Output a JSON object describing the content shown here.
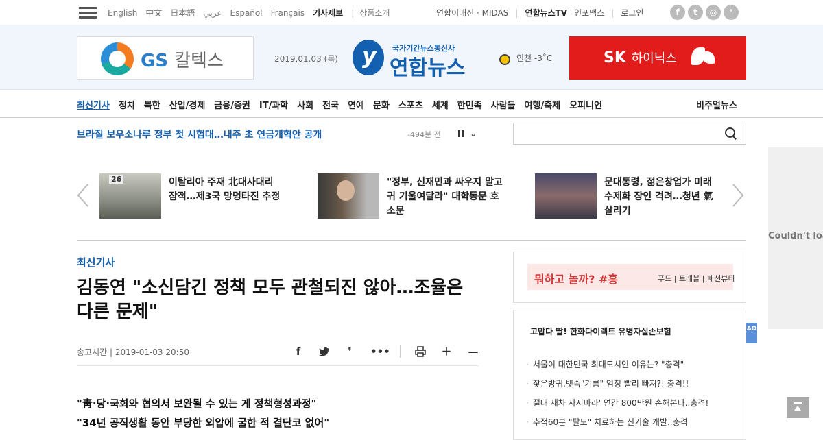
{
  "topbar": {
    "langs": [
      "English",
      "中文",
      "日本語",
      "عربي",
      "Español",
      "Français"
    ],
    "report_label": "기사제보",
    "product_label": "상품소개",
    "links": [
      "연합이매진 · MIDAS"
    ],
    "tv_label": "연합뉴스TV",
    "infomax_label": "인포맥스",
    "login_label": "로그인",
    "social": [
      "f",
      "t",
      "◎",
      "❜"
    ]
  },
  "header": {
    "gs_brand": "GS",
    "gs_name": "칼텍스",
    "date": "2019.01.03 (목)",
    "logo_sub": "국가기간뉴스통신사",
    "logo_main": "연합뉴스",
    "weather": "인천 -3˚C",
    "sk_brand": "SK",
    "sk_name": "하이닉스"
  },
  "nav": {
    "items": [
      "최신기사",
      "정치",
      "북한",
      "산업/경제",
      "금융/증권",
      "IT/과학",
      "사회",
      "전국",
      "연예",
      "문화",
      "스포츠",
      "세계",
      "한민족",
      "사람들",
      "여행/축제",
      "오피니언"
    ],
    "visual": "비주얼뉴스"
  },
  "ticker": {
    "headline": "브라질 보우소나루 정부 첫 시험대…내주 초 연금개혁안 공개",
    "time": "-494분 전"
  },
  "search": {
    "placeholder": ""
  },
  "carousel": [
    {
      "title": "이탈리아 주재 北대사대리 잠적…제3국 망명타진 추정"
    },
    {
      "title": "\"정부, 신재민과 싸우지 말고 귀 기울여달라\" 대학동문 호소문"
    },
    {
      "title": "문대통령, 젊은창업가 미래 수제화 장인 격려…청년 氣살리기"
    }
  ],
  "article": {
    "category": "최신기사",
    "headline": "김동연 \"소신담긴 정책 모두 관철되진 않아…조율은 다른 문제\"",
    "pubtime": "송고시간 | 2019-01-03 20:50",
    "subheads": [
      "\"靑·당·국회와 협의서 보완될 수 있는 게 정책형성과정\"",
      "\"34년 공직생활 동안 부당한 외압에 굴한 적 결단코 없어\""
    ]
  },
  "sidebar": {
    "ad_banner_main": "뭐하고 놀까? #흥",
    "ad_banner_tags": "푸드 | 트래블 | 패션뷰티",
    "box_title": "고맙다 딸! 한화다이렉트 유병자실손보험",
    "items": [
      "서울이 대한민국 최대도시인 이유는? \"충격\"",
      "잦은방귀,뱃속\"기름\" 엄청 빨리 빠져?! 충격!!",
      "절대 새차 사지마라' 연간 800만원 손해본다..충격!",
      "추적60분 \"탈모\" 치료하는 신기술 개발..충격"
    ],
    "ad_badge": "AD"
  },
  "right_ad": {
    "text": "Couldn't load"
  }
}
